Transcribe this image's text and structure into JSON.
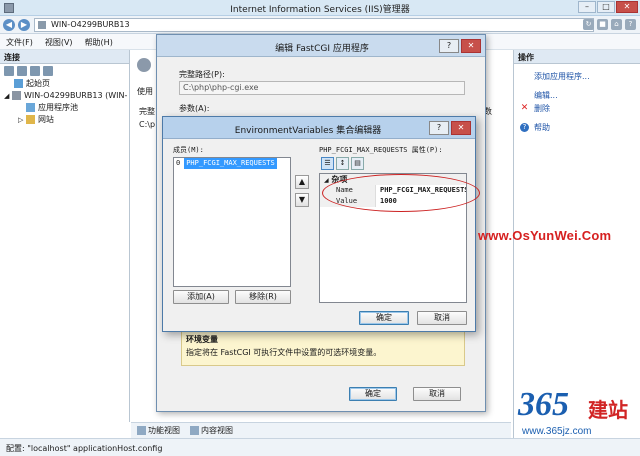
{
  "window": {
    "title": "Internet Information Services (IIS)管理器",
    "min": "–",
    "max": "□",
    "close": "✕"
  },
  "address": {
    "path": "WIN-O4299BURB13"
  },
  "menu": [
    "文件(F)",
    "视图(V)",
    "帮助(H)"
  ],
  "connections": {
    "header": "连接",
    "tree": [
      "起始页",
      "WIN-O4299BURB13 (WIN-",
      "应用程序池",
      "网站"
    ]
  },
  "center_fragments": {
    "use": "使用",
    "complete": "完整",
    "cpath": "C:\\p",
    "num": "数"
  },
  "actions": {
    "header": "操作",
    "items": [
      "添加应用程序...",
      "编辑...",
      "删除",
      "帮助"
    ]
  },
  "bottom_tabs": [
    "功能视图",
    "内容视图"
  ],
  "status": "配置: \"localhost\" applicationHost.config",
  "fcgi": {
    "title": "编辑 FastCGI 应用程序",
    "help": "?",
    "close": "✕",
    "full_path_label": "完整路径(P):",
    "full_path_value": "C:\\php\\php-cgi.exe",
    "args_label": "参数(A):",
    "desc_title": "环境变量",
    "desc_text": "指定将在 FastCGI 可执行文件中设置的可选环境变量。",
    "ok": "确定",
    "cancel": "取消"
  },
  "env": {
    "title": "EnvironmentVariables 集合编辑器",
    "help": "?",
    "close": "✕",
    "members_label": "成员(M):",
    "members": [
      {
        "index": "0",
        "name": "PHP_FCGI_MAX_REQUESTS"
      }
    ],
    "up": "▲",
    "down": "▼",
    "add": "添加(A)",
    "remove": "移除(R)",
    "props_label": "PHP_FCGI_MAX_REQUESTS 属性(P):",
    "category": "杂项",
    "props": [
      {
        "key": "Name",
        "value": "PHP_FCGI_MAX_REQUESTS"
      },
      {
        "key": "Value",
        "value": "1000"
      }
    ],
    "ok": "确定",
    "cancel": "取消"
  },
  "watermark": {
    "site": "www.OsYunWei.Com",
    "logo_num": "365",
    "logo_cn": "建站",
    "logo_url": "www.365jz.com"
  }
}
